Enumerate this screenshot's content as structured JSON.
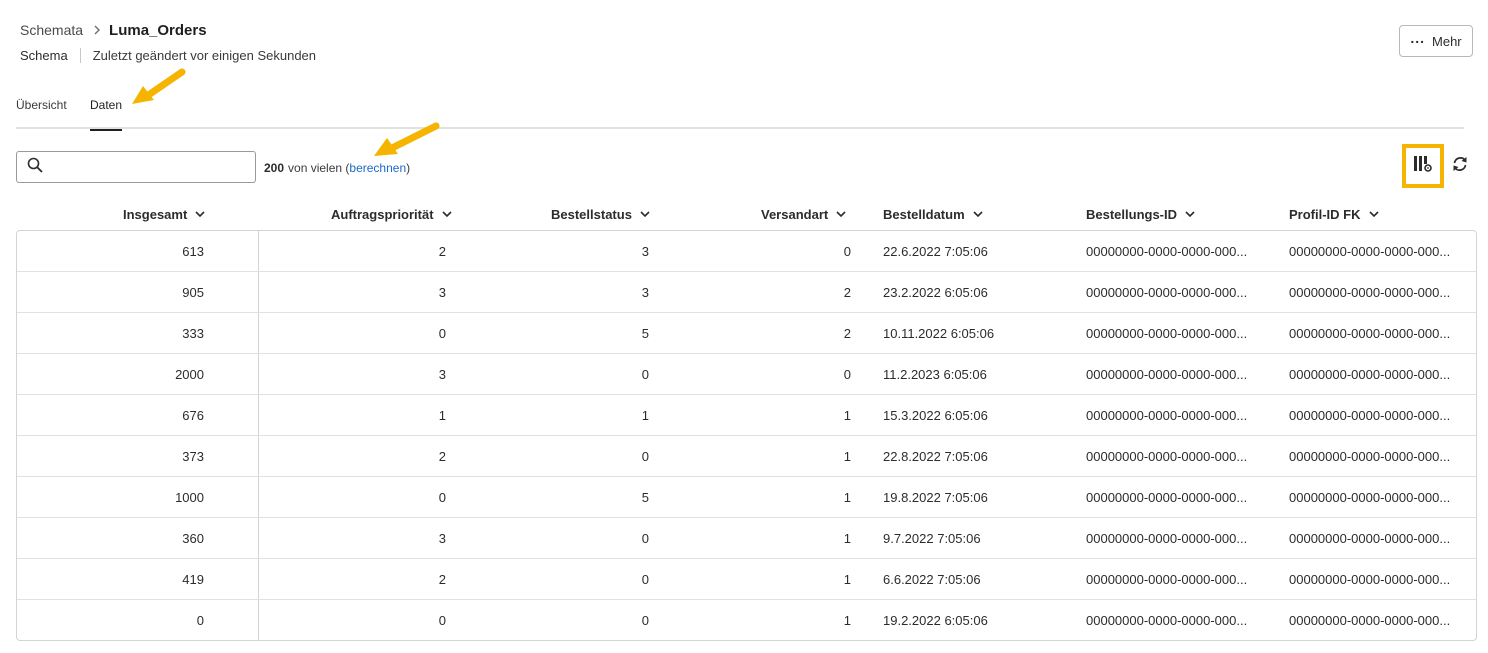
{
  "breadcrumb": {
    "parent": "Schemata",
    "current": "Luma_Orders"
  },
  "header": {
    "type": "Schema",
    "modified": "Zuletzt geändert vor einigen Sekunden",
    "more_label": "Mehr"
  },
  "tabs": [
    {
      "label": "Übersicht"
    },
    {
      "label": "Daten"
    }
  ],
  "toolbar": {
    "search_placeholder": "",
    "count_value": "200",
    "count_text": "von vielen (",
    "count_link": "berechnen",
    "count_close": ")"
  },
  "colors": {
    "accent": "#1b6ac9",
    "highlight": "#f5b400",
    "text": "#2c2c2c"
  },
  "icons": [
    "chevron-right-icon",
    "more-dots-icon",
    "search-icon",
    "column-settings-icon",
    "refresh-icon",
    "chevron-down-icon",
    "arrow-annotation-icon"
  ],
  "table": {
    "columns": [
      "Insgesamt",
      "Auftragspriorität",
      "Bestellstatus",
      "Versandart",
      "Bestelldatum",
      "Bestellungs-ID",
      "Profil-ID FK"
    ],
    "rows": [
      [
        "613",
        "2",
        "3",
        "0",
        "22.6.2022 7:05:06",
        "00000000-0000-0000-000...",
        "00000000-0000-0000-000..."
      ],
      [
        "905",
        "3",
        "3",
        "2",
        "23.2.2022 6:05:06",
        "00000000-0000-0000-000...",
        "00000000-0000-0000-000..."
      ],
      [
        "333",
        "0",
        "5",
        "2",
        "10.11.2022 6:05:06",
        "00000000-0000-0000-000...",
        "00000000-0000-0000-000..."
      ],
      [
        "2000",
        "3",
        "0",
        "0",
        "11.2.2023 6:05:06",
        "00000000-0000-0000-000...",
        "00000000-0000-0000-000..."
      ],
      [
        "676",
        "1",
        "1",
        "1",
        "15.3.2022 6:05:06",
        "00000000-0000-0000-000...",
        "00000000-0000-0000-000..."
      ],
      [
        "373",
        "2",
        "0",
        "1",
        "22.8.2022 7:05:06",
        "00000000-0000-0000-000...",
        "00000000-0000-0000-000..."
      ],
      [
        "1000",
        "0",
        "5",
        "1",
        "19.8.2022 7:05:06",
        "00000000-0000-0000-000...",
        "00000000-0000-0000-000..."
      ],
      [
        "360",
        "3",
        "0",
        "1",
        "9.7.2022 7:05:06",
        "00000000-0000-0000-000...",
        "00000000-0000-0000-000..."
      ],
      [
        "419",
        "2",
        "0",
        "1",
        "6.6.2022 7:05:06",
        "00000000-0000-0000-000...",
        "00000000-0000-0000-000..."
      ],
      [
        "0",
        "0",
        "0",
        "1",
        "19.2.2022 6:05:06",
        "00000000-0000-0000-000...",
        "00000000-0000-0000-000..."
      ]
    ]
  }
}
